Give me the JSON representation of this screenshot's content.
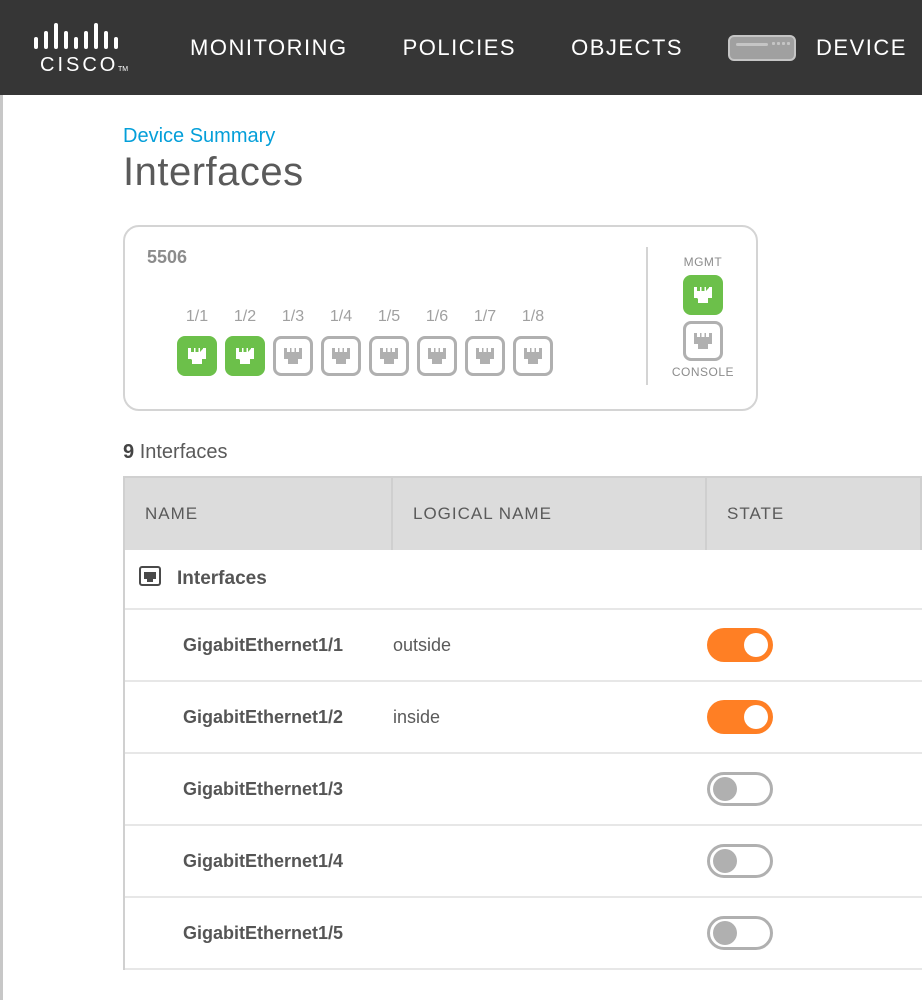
{
  "nav": {
    "monitoring": "MONITORING",
    "policies": "POLICIES",
    "objects": "OBJECTS",
    "device": "DEVICE"
  },
  "breadcrumb": "Device Summary",
  "page_title": "Interfaces",
  "device_panel": {
    "model": "5506",
    "ports": [
      {
        "label": "1/1",
        "active": true
      },
      {
        "label": "1/2",
        "active": true
      },
      {
        "label": "1/3",
        "active": false
      },
      {
        "label": "1/4",
        "active": false
      },
      {
        "label": "1/5",
        "active": false
      },
      {
        "label": "1/6",
        "active": false
      },
      {
        "label": "1/7",
        "active": false
      },
      {
        "label": "1/8",
        "active": false
      }
    ],
    "mgmt_label": "MGMT",
    "mgmt_active": true,
    "console_label": "CONSOLE",
    "console_active": false
  },
  "iface_count_num": "9",
  "iface_count_label": "Interfaces",
  "table": {
    "headers": {
      "name": "NAME",
      "logical": "LOGICAL NAME",
      "state": "STATE"
    },
    "group_label": "Interfaces",
    "rows": [
      {
        "name": "GigabitEthernet1/1",
        "logical": "outside",
        "state": true
      },
      {
        "name": "GigabitEthernet1/2",
        "logical": "inside",
        "state": true
      },
      {
        "name": "GigabitEthernet1/3",
        "logical": "",
        "state": false
      },
      {
        "name": "GigabitEthernet1/4",
        "logical": "",
        "state": false
      },
      {
        "name": "GigabitEthernet1/5",
        "logical": "",
        "state": false
      }
    ]
  }
}
